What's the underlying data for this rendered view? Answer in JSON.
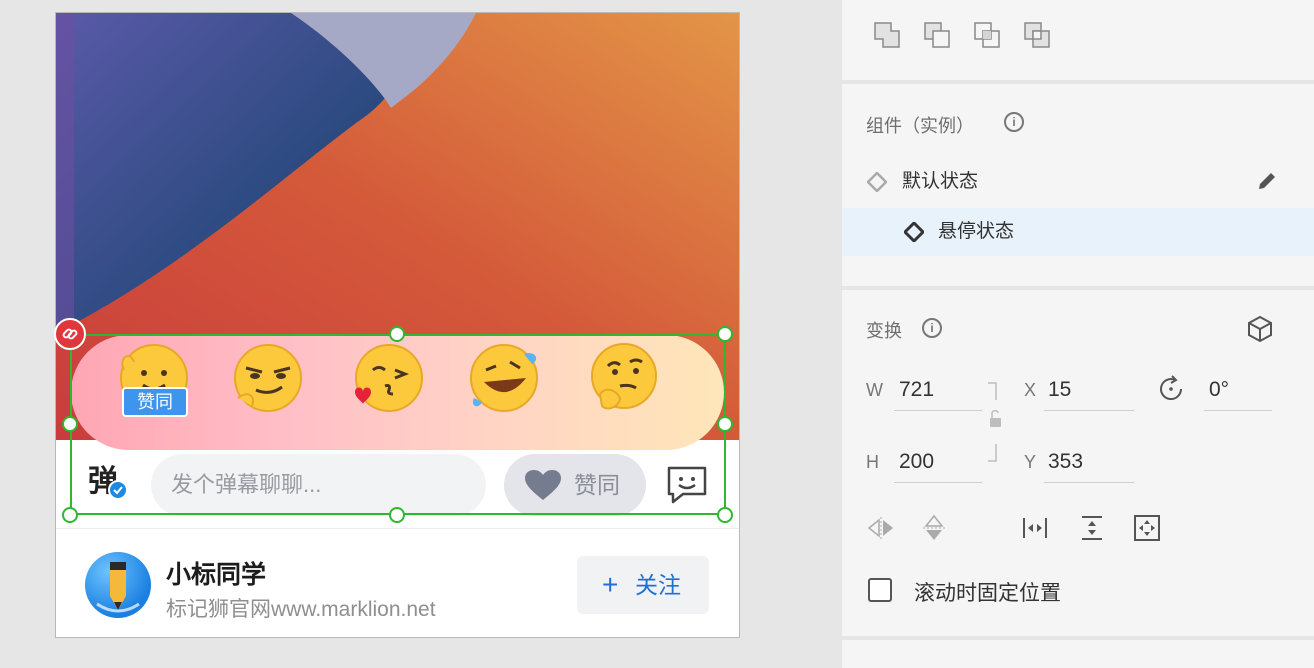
{
  "canvas": {
    "reactions": [
      "赞同",
      "坏笑",
      "亲亲",
      "笑哭",
      "思考"
    ],
    "zan_badge": "赞同",
    "danmu": {
      "logo_char": "弹",
      "input_placeholder": "发个弹幕聊聊...",
      "like_label": "赞同"
    },
    "profile": {
      "name": "小标同学",
      "subtitle": "标记狮官网www.marklion.net",
      "follow_label": "关注",
      "follow_plus": "+"
    }
  },
  "panel": {
    "component": {
      "title": "组件（实例）",
      "states": [
        "默认状态",
        "悬停状态"
      ],
      "active_state": "悬停状态"
    },
    "transform": {
      "title": "变换",
      "w_label": "W",
      "w": "721",
      "h_label": "H",
      "h": "200",
      "x_label": "X",
      "x": "15",
      "y_label": "Y",
      "y": "353",
      "rotation": "0°"
    },
    "fix_position_label": "滚动时固定位置",
    "fix_position_checked": false
  },
  "colors": {
    "selection": "#2eb82e",
    "accent_blue": "#1e6fd9",
    "active_row": "#e8f2fb",
    "link_badge": "#e0363c"
  }
}
